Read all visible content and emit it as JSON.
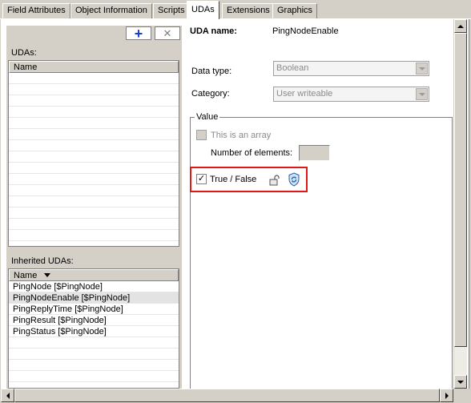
{
  "tabs": [
    {
      "label": "Field Attributes",
      "active": false
    },
    {
      "label": "Object Information",
      "active": false
    },
    {
      "label": "Scripts",
      "active": false
    },
    {
      "label": "UDAs",
      "active": true
    },
    {
      "label": "Extensions",
      "active": false
    },
    {
      "label": "Graphics",
      "active": false
    }
  ],
  "toolbar": {
    "add_icon": "plus-icon",
    "delete_icon": "close-icon"
  },
  "udas": {
    "header": "UDAs:",
    "column": "Name",
    "rows": []
  },
  "inherited": {
    "header": "Inherited UDAs:",
    "column": "Name",
    "rows": [
      "PingNode [$PingNode]",
      "PingNodeEnable [$PingNode]",
      "PingReplyTime [$PingNode]",
      "PingResult [$PingNode]",
      "PingStatus [$PingNode]"
    ],
    "selected_index": 1
  },
  "detail": {
    "uda_name_label": "UDA name:",
    "uda_name_value": "PingNodeEnable",
    "data_type_label": "Data type:",
    "data_type_value": "Boolean",
    "category_label": "Category:",
    "category_value": "User writeable",
    "value_group": "Value",
    "array_label": "This is an array",
    "array_checked": false,
    "num_elements_label": "Number of elements:",
    "num_elements_value": "",
    "true_false_label": "True / False",
    "true_false_checked": true,
    "lock_icon": "lock-icon",
    "sync_icon": "sync-icon"
  },
  "colors": {
    "highlight": "#e01818",
    "accent": "#1a3fd0"
  }
}
